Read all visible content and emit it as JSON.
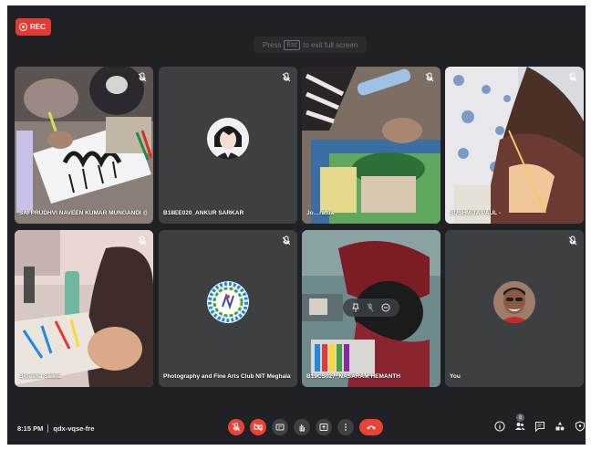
{
  "recording": {
    "label": "REC",
    "color": "#e53935"
  },
  "fullscreen_hint": {
    "before": "Press",
    "key": "Esc",
    "after": "to exit full screen"
  },
  "participants": [
    {
      "name": "SAI PRUDHVI NAVEEN KUMAR MUNGANDI @",
      "muted": true,
      "mute_icon": "mic-off-icon"
    },
    {
      "name": "B18EE020_ANKUR SARKAR",
      "muted": true,
      "mute_icon": "mic-off-icon"
    },
    {
      "name": "Jo…ratua",
      "muted": true,
      "mute_icon": "mic-off-icon"
    },
    {
      "name": "SUSHMITA PAUL -",
      "muted": true,
      "mute_icon": "mic-off-icon"
    },
    {
      "name": "Bipasha Saikia",
      "muted": true,
      "mute_icon": "mic-off-icon"
    },
    {
      "name": "Photography and Fine Arts Club NIT Meghalaya",
      "muted": true,
      "mute_icon": "mic-off-icon"
    },
    {
      "name": "B19CS027_NASARAM HEMANTH",
      "muted": false,
      "mute_icon": ""
    },
    {
      "name": "You",
      "muted": true,
      "mute_icon": "mic-off-icon"
    }
  ],
  "bottom_bar": {
    "time": "8:15 PM",
    "meeting_code": "qdx-vqse-fre",
    "controls": [
      {
        "name": "mic-off-icon",
        "state": "off",
        "color": "#ea4335"
      },
      {
        "name": "camera-off-icon",
        "state": "off",
        "color": "#ea4335"
      },
      {
        "name": "captions-icon",
        "state": "neutral",
        "color": "#3c4043"
      },
      {
        "name": "raise-hand-icon",
        "state": "neutral",
        "color": "#3c4043"
      },
      {
        "name": "present-icon",
        "state": "neutral",
        "color": "#3c4043"
      },
      {
        "name": "more-options-icon",
        "state": "neutral",
        "color": "#3c4043"
      },
      {
        "name": "end-call-icon",
        "state": "danger",
        "color": "#ea4335"
      }
    ],
    "right_icons": [
      "info-icon",
      "people-icon",
      "chat-icon",
      "activities-icon",
      "host-controls-icon"
    ],
    "people_count": "8"
  }
}
